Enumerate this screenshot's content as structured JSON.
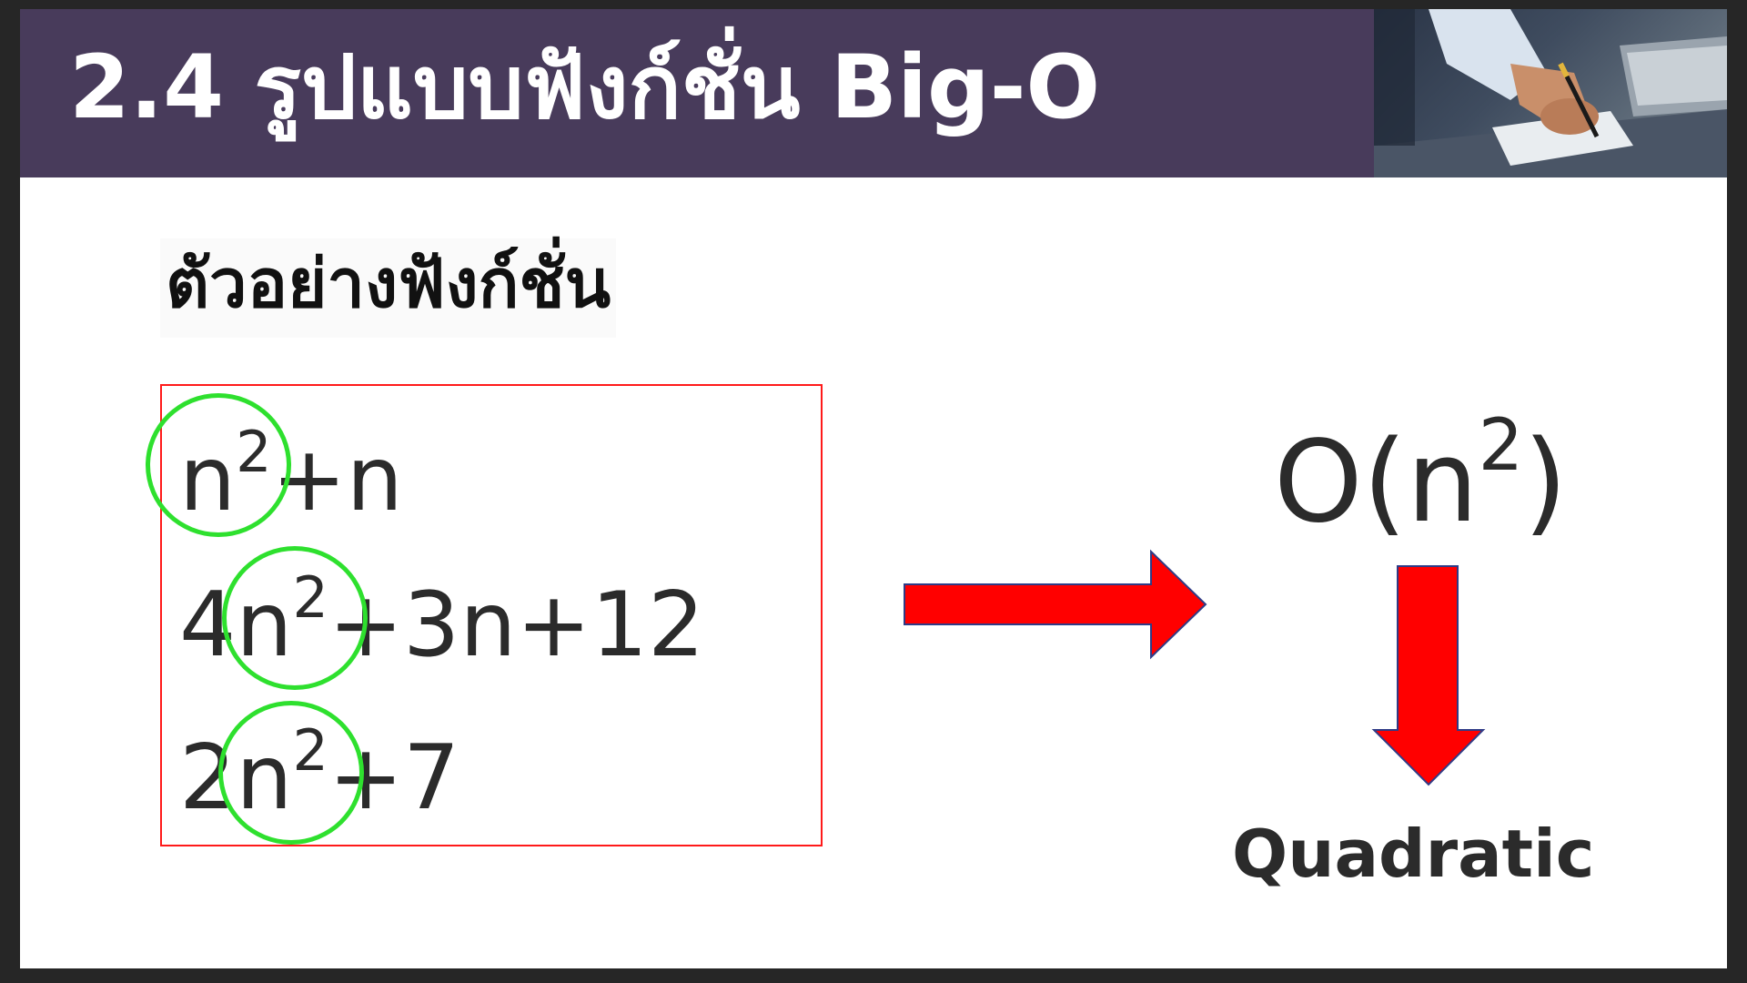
{
  "header": {
    "title": "2.4 รูปแบบฟังก์ชั่น Big-O",
    "photo_icon": "person-writing-photo"
  },
  "subtitle": "ตัวอย่างฟังก์ชั่น",
  "examples": [
    {
      "base": "n",
      "exp": "2",
      "rest": "+n"
    },
    {
      "lead": "4",
      "base": "n",
      "exp": "2",
      "rest": "+3n+12"
    },
    {
      "lead": "2",
      "base": "n",
      "exp": "2",
      "rest": "+7"
    }
  ],
  "result": {
    "open": "O(n",
    "exp": "2",
    "close": ")"
  },
  "classification": "Quadratic",
  "colors": {
    "header_bg": "#483b5b",
    "box_border": "#ff1a1a",
    "highlight_circle": "#2ee02e",
    "arrow_fill": "#ff0000",
    "arrow_outline": "#2f3b86"
  }
}
